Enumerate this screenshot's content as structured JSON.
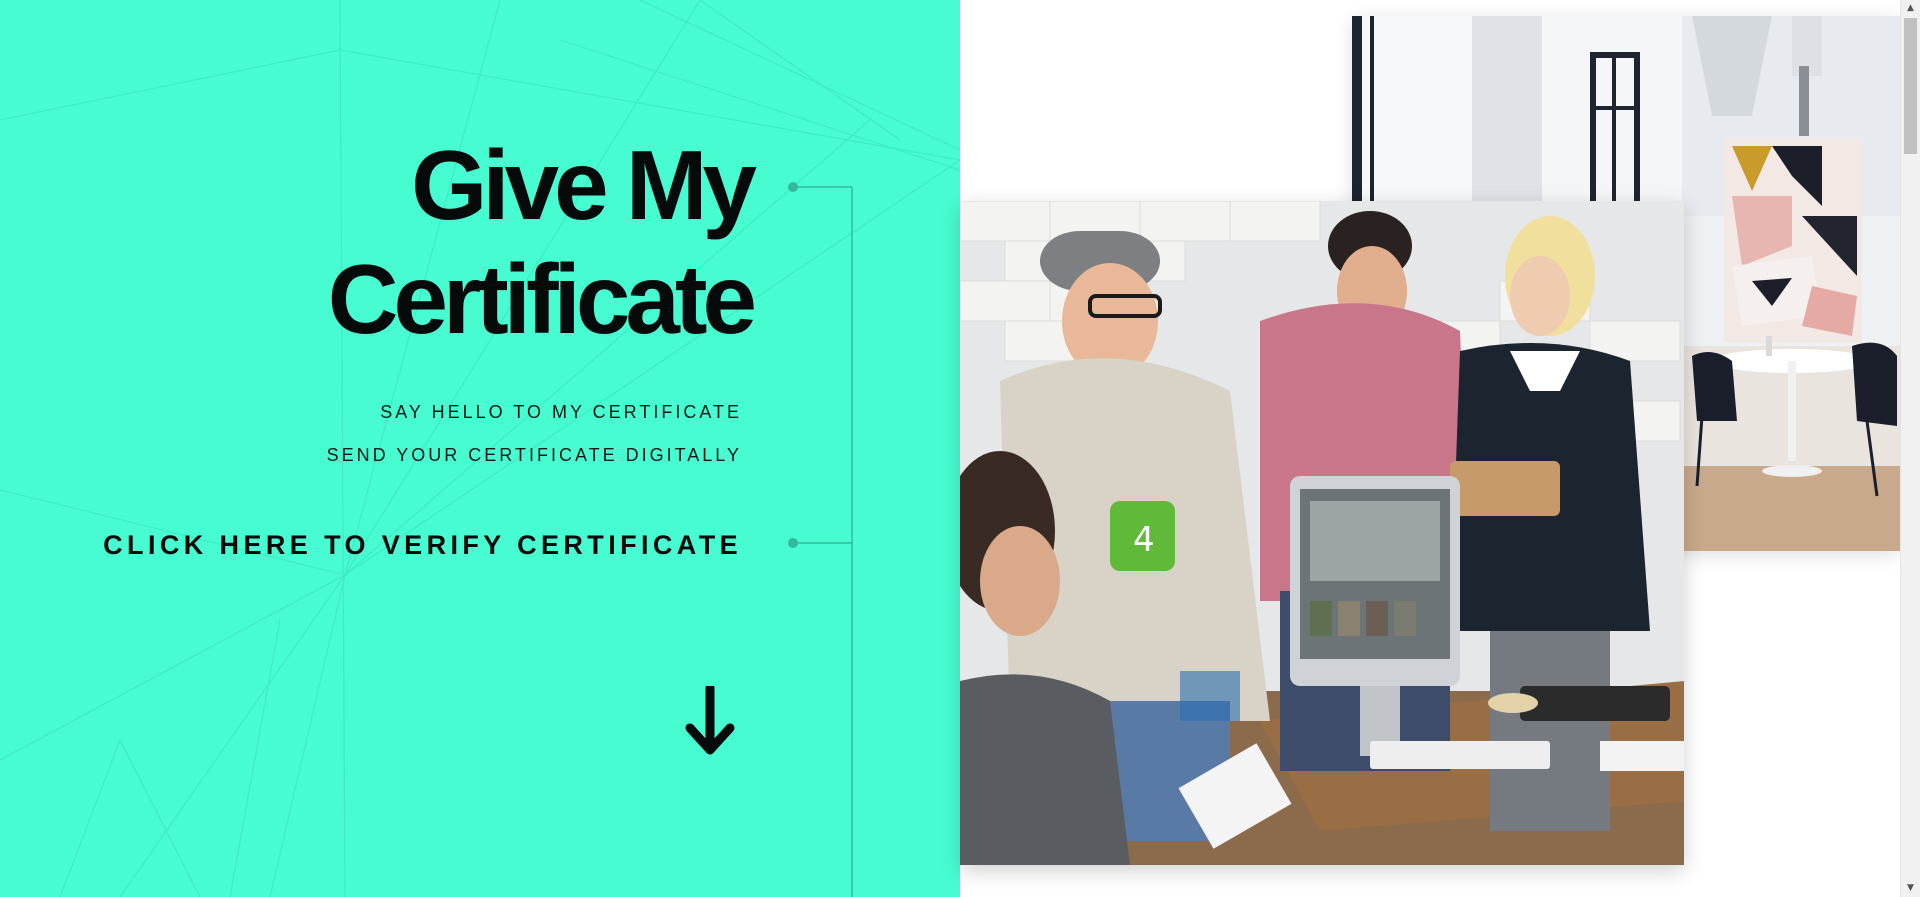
{
  "hero": {
    "title_line1": "Give My",
    "title_line2": "Certificate",
    "tagline1": "SAY HELLO TO MY CERTIFICATE",
    "tagline2": "SEND YOUR CERTIFICATE DIGITALLY",
    "verify_link": "CLICK HERE TO VERIFY CERTIFICATE"
  },
  "icons": {
    "scroll_down": "arrow-down-icon",
    "scroll_up": "scroll-up-arrow",
    "scroll_down_small": "scroll-down-arrow"
  },
  "scrollbar": {
    "up_glyph": "▲",
    "down_glyph": "▼"
  },
  "colors": {
    "accent": "#48fcd2",
    "text": "#070a0a",
    "connector": "#34b99a",
    "background": "#ffffff"
  }
}
